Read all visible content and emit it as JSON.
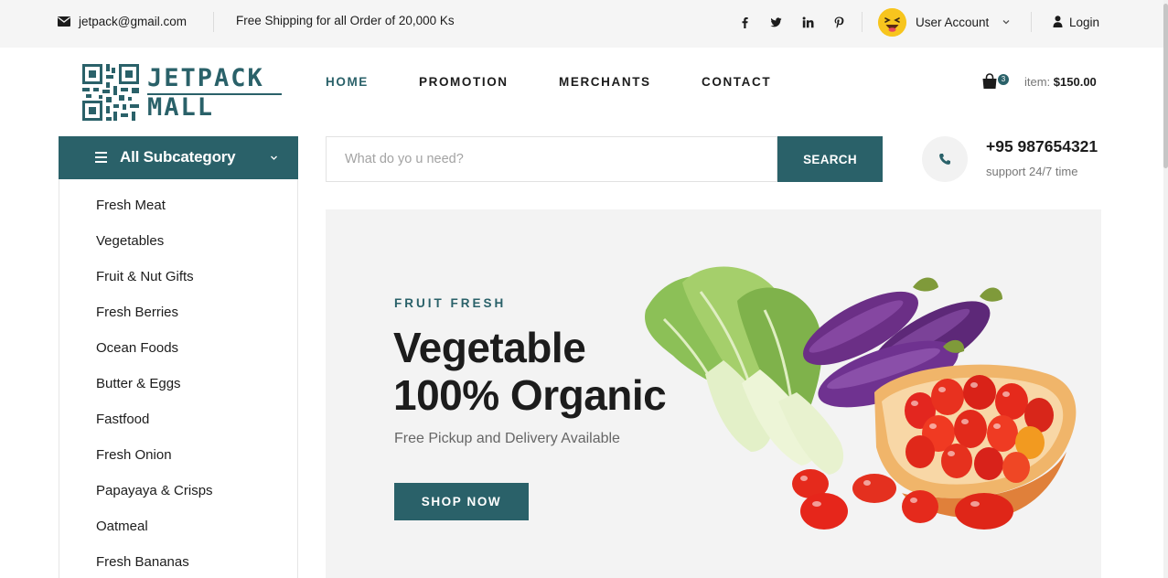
{
  "topbar": {
    "email": "jetpack@gmail.com",
    "shipping": "Free Shipping for all Order of 20,000 Ks",
    "social": [
      "facebook-icon",
      "twitter-icon",
      "linkedin-icon",
      "pinterest-icon"
    ],
    "user_account": "User Account",
    "login": "Login"
  },
  "logo": {
    "line1": "JETPACK",
    "line2": "MALL"
  },
  "nav": [
    "HOME",
    "PROMOTION",
    "MERCHANTS",
    "CONTACT"
  ],
  "cart": {
    "count": "3",
    "label": "item:",
    "amount": "$150.00"
  },
  "categories": {
    "title": "All Subcategory",
    "items": [
      "Fresh Meat",
      "Vegetables",
      "Fruit & Nut Gifts",
      "Fresh Berries",
      "Ocean Foods",
      "Butter & Eggs",
      "Fastfood",
      "Fresh Onion",
      "Papayaya & Crisps",
      "Oatmeal",
      "Fresh Bananas"
    ]
  },
  "search": {
    "placeholder": "What do yo u need?",
    "button": "SEARCH"
  },
  "support": {
    "phone": "+95 987654321",
    "note": "support 24/7 time"
  },
  "hero": {
    "kicker": "FRUIT FRESH",
    "title_line1": "Vegetable",
    "title_line2": "100% Organic",
    "subtitle": "Free Pickup and Delivery Available",
    "button": "SHOP NOW"
  },
  "colors": {
    "accent": "#2a6169",
    "topbar_bg": "#f5f5f5",
    "hero_bg": "#f3f3f3"
  }
}
